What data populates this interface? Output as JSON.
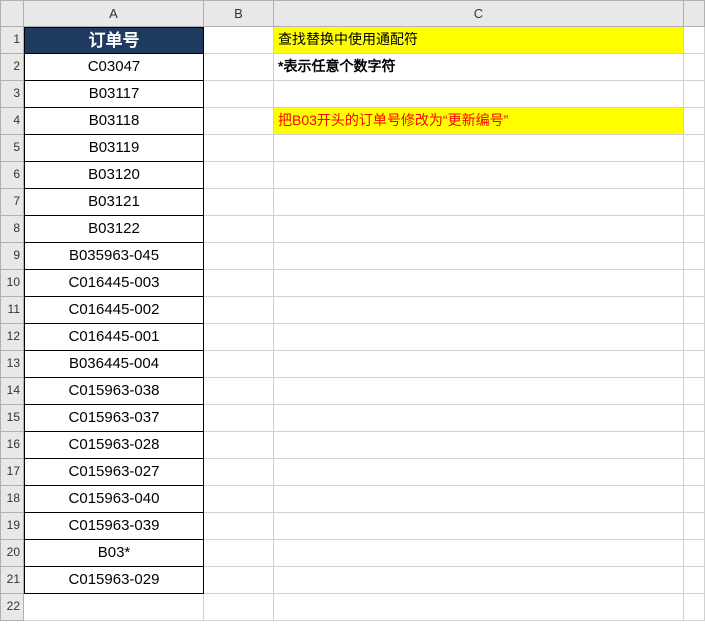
{
  "columns": [
    "A",
    "B",
    "C",
    ""
  ],
  "rows": [
    "1",
    "2",
    "3",
    "4",
    "5",
    "6",
    "7",
    "8",
    "9",
    "10",
    "11",
    "12",
    "13",
    "14",
    "15",
    "16",
    "17",
    "18",
    "19",
    "20",
    "21",
    "22"
  ],
  "colA": {
    "header": "订单号",
    "values": [
      "C03047",
      "B03117",
      "B03118",
      "B03119",
      "B03120",
      "B03121",
      "B03122",
      "B035963-045",
      "C016445-003",
      "C016445-002",
      "C016445-001",
      "B036445-004",
      "C015963-038",
      "C015963-037",
      "C015963-028",
      "C015963-027",
      "C015963-040",
      "C015963-039",
      "B03*",
      "C015963-029"
    ]
  },
  "colC": {
    "title": "查找替换中使用通配符",
    "note": "*表示任意个数字符",
    "task": "把B03开头的订单号修改为“更新编号”"
  }
}
